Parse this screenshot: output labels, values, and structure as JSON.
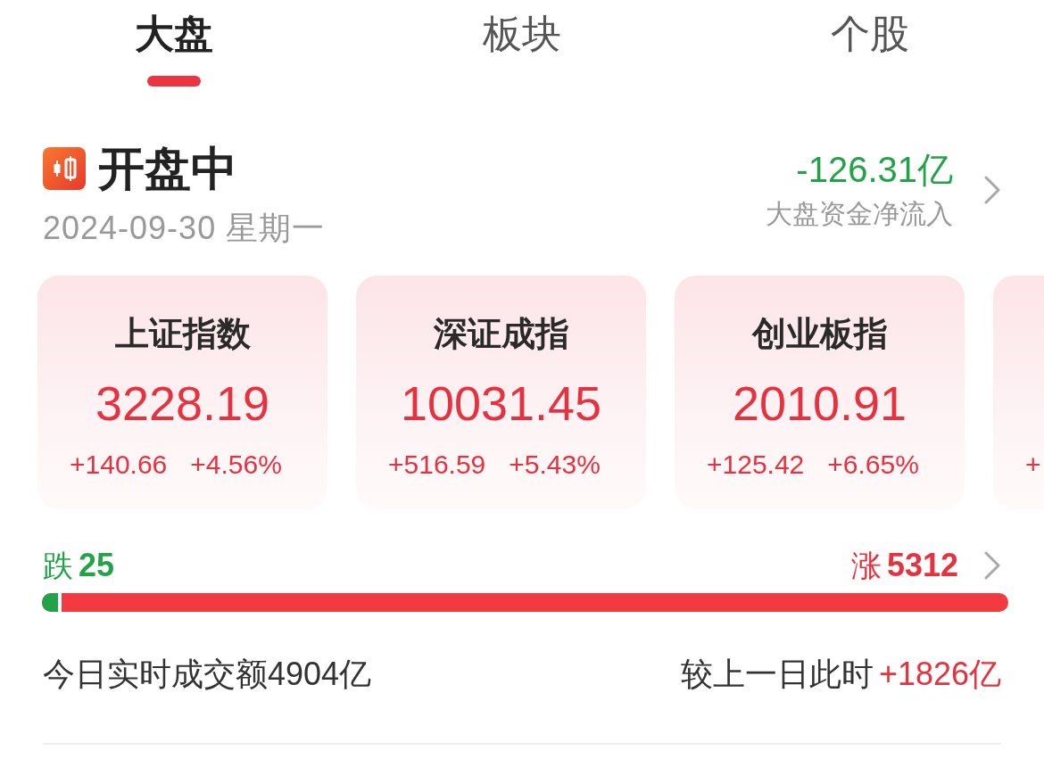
{
  "tabs": [
    {
      "label": "大盘",
      "selected": true
    },
    {
      "label": "板块",
      "selected": false
    },
    {
      "label": "个股",
      "selected": false
    }
  ],
  "market_status": {
    "label": "开盘中",
    "date": "2024-09-30 星期一"
  },
  "net_flow": {
    "value": "-126.31亿",
    "label": "大盘资金净流入"
  },
  "index_cards": [
    {
      "name": "上证指数",
      "value": "3228.19",
      "change": "+140.66",
      "change_pct": "+4.56%"
    },
    {
      "name": "深证成指",
      "value": "10031.45",
      "change": "+516.59",
      "change_pct": "+5.43%"
    },
    {
      "name": "创业板指",
      "value": "2010.91",
      "change": "+125.42",
      "change_pct": "+6.65%"
    },
    {
      "change": "+"
    }
  ],
  "breadth": {
    "fall_label": "跌",
    "fall_count": "25",
    "rise_label": "涨",
    "rise_count": "5312",
    "level": 0.02
  },
  "turnover": {
    "text": "今日实时成交额4904亿",
    "compare_label": "较上一日此时",
    "compare_value": "+1826亿"
  }
}
